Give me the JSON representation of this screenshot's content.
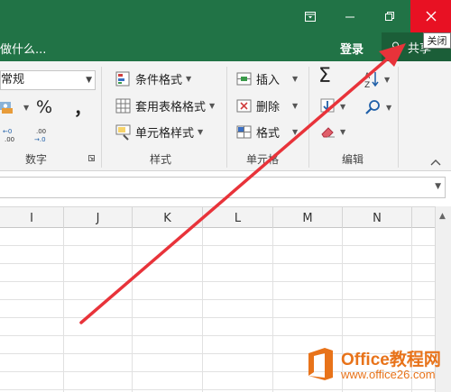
{
  "titlebar": {
    "ribbon_options_icon": "ribbon-display-options-icon",
    "minimize_icon": "minimize-icon",
    "restore_icon": "restore-icon",
    "close_icon": "close-icon",
    "tooltip": "关闭"
  },
  "tellbar": {
    "tell_me_text": "做什么...",
    "signin": "登录",
    "share": "共享"
  },
  "ribbon": {
    "number": {
      "format_value": "常规",
      "percent": "%",
      "comma": "，",
      "label": "数字"
    },
    "styles": {
      "conditional": "条件格式",
      "table": "套用表格格式",
      "cell": "单元格样式",
      "label": "样式"
    },
    "cells": {
      "insert": "插入",
      "delete": "删除",
      "format": "格式",
      "label": "单元格"
    },
    "editing": {
      "autosum": "Σ",
      "label": "编辑"
    }
  },
  "grid": {
    "columns": [
      "I",
      "J",
      "K",
      "L",
      "M",
      "N"
    ]
  },
  "watermark": {
    "title": "Office教程网",
    "url": "www.office26.com"
  },
  "colors": {
    "titlebar": "#217346",
    "close": "#e81123",
    "arrow": "#e8333a",
    "watermark": "#e8731a"
  }
}
